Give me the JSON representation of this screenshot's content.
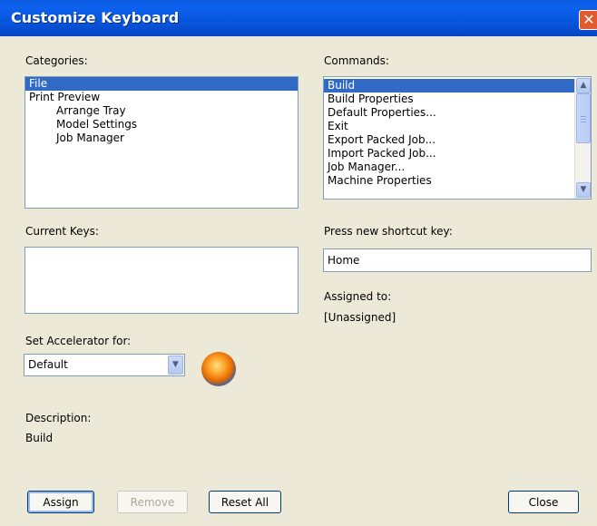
{
  "window": {
    "title": "Customize Keyboard",
    "close_glyph": "✕"
  },
  "labels": {
    "categories": "Categories:",
    "commands": "Commands:",
    "current_keys": "Current Keys:",
    "press_new_shortcut": "Press new shortcut key:",
    "assigned_to": "Assigned to:",
    "assigned_value": "[Unassigned]",
    "set_accelerator": "Set Accelerator for:",
    "description": "Description:",
    "description_value": "Build"
  },
  "categories": [
    {
      "label": "File",
      "selected": true,
      "indent": 0
    },
    {
      "label": "Print Preview",
      "selected": false,
      "indent": 0
    },
    {
      "label": "Arrange Tray",
      "selected": false,
      "indent": 1
    },
    {
      "label": "Model Settings",
      "selected": false,
      "indent": 1
    },
    {
      "label": "Job Manager",
      "selected": false,
      "indent": 1
    }
  ],
  "commands": [
    {
      "label": "Build",
      "selected": true
    },
    {
      "label": "Build Properties",
      "selected": false
    },
    {
      "label": "Default Properties...",
      "selected": false
    },
    {
      "label": "Exit",
      "selected": false
    },
    {
      "label": "Export Packed Job...",
      "selected": false
    },
    {
      "label": "Import Packed Job...",
      "selected": false
    },
    {
      "label": "Job Manager...",
      "selected": false
    },
    {
      "label": "Machine Properties",
      "selected": false
    }
  ],
  "shortcut_input": {
    "value": "Home"
  },
  "current_keys": [],
  "accelerator": {
    "selected": "Default"
  },
  "buttons": {
    "assign": "Assign",
    "remove": "Remove",
    "reset_all": "Reset All",
    "close": "Close"
  },
  "icons": {
    "scroll_up": "▲",
    "scroll_down": "▼",
    "dropdown": "▼",
    "orb": "app-orb-icon"
  },
  "colors": {
    "title_bar": "#0a5ae0",
    "selection": "#316ac5",
    "dialog_bg": "#ece9d8",
    "close_button": "#e35a2e"
  }
}
